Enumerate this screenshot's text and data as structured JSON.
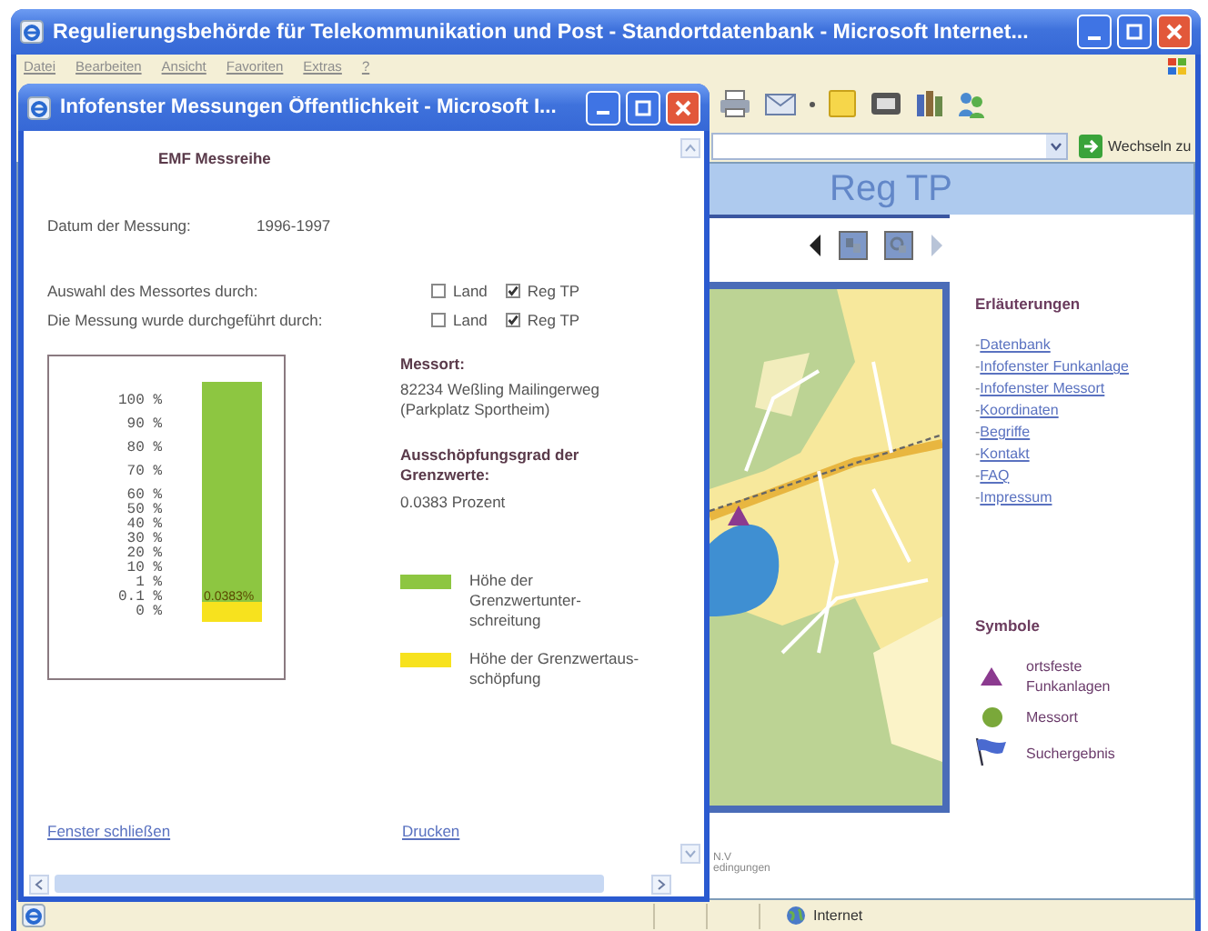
{
  "main_window": {
    "title": "Regulierungsbehörde für Telekommunikation und Post - Standortdatenbank - Microsoft Internet...",
    "menu": [
      "Datei",
      "Bearbeiten",
      "Ansicht",
      "Favoriten",
      "Extras",
      "?"
    ],
    "address_bar": {
      "go_button": "Wechseln zu"
    },
    "header": {
      "title": "Reg TP"
    },
    "map_nav": [
      {
        "kind": "prev",
        "disabled": false
      },
      {
        "kind": "zoom-in",
        "disabled": false
      },
      {
        "kind": "zoom-out",
        "disabled": false
      },
      {
        "kind": "next",
        "disabled": true
      }
    ],
    "map": {
      "kind": "picture"
    },
    "sidebar": {
      "heading": "Erläuterungen",
      "links": [
        {
          "marker": "-",
          "label": "Datenbank"
        },
        {
          "marker": "-",
          "label": "Infofenster Funkanlage"
        },
        {
          "marker": "-",
          "label": "Infofenster Messort"
        },
        {
          "marker": "-",
          "label": "Koordinaten"
        },
        {
          "marker": "-",
          "label": "Begriffe"
        },
        {
          "marker": "-",
          "label": "Kontakt"
        },
        {
          "marker": "-",
          "label": "FAQ"
        },
        {
          "marker": "-",
          "label": "Impressum"
        }
      ],
      "symbols_heading": "Symbole",
      "symbols": [
        {
          "kind": "triangle",
          "label": "ortsfeste Funkanlagen",
          "color": "#8b3a8f"
        },
        {
          "kind": "dot",
          "label": "Messort",
          "color": "#7aa83a"
        },
        {
          "kind": "flag",
          "label": "Suchergebnis",
          "color": "#4a6ad0"
        }
      ]
    },
    "footer": [
      "N.V",
      "edingungen"
    ],
    "status_bar": {
      "zone": "Internet"
    }
  },
  "popup": {
    "title": "Infofenster Messungen Öffentlichkeit - Microsoft I...",
    "heading": "EMF Messreihe",
    "date": {
      "label": "Datum der Messung:",
      "value": "1996-1997"
    },
    "options": [
      {
        "label": "Auswahl des Messortes durch:",
        "choices": [
          {
            "label": "Land",
            "checked": false
          },
          {
            "label": "Reg TP",
            "checked": true
          }
        ]
      },
      {
        "label": "Die Messung wurde durchgeführt durch:",
        "choices": [
          {
            "label": "Land",
            "checked": false
          },
          {
            "label": "Reg TP",
            "checked": true
          }
        ]
      }
    ],
    "gauge": {
      "scale": [
        "100 %",
        "90 %",
        "80 %",
        "70 %",
        "60 %",
        "50 %",
        "40 %",
        "30 %",
        "20 %",
        "10 %",
        "1 %",
        "0.1 %",
        "0 %"
      ],
      "value_label": "0.0383%",
      "segments": [
        {
          "label": "Höhe der Grenzwertunter- schreitung",
          "color": "#8dc641"
        },
        {
          "label": "Höhe der Grenzwertaus- schöpfung",
          "color": "#f7e21e"
        }
      ]
    },
    "location": {
      "label": "Messort:",
      "value": "82234 Weßling Mailingerweg (Parkplatz Sportheim)"
    },
    "utilization": {
      "label": "Ausschöpfungsgrad der Grenzwerte:",
      "value": "0.0383 Prozent"
    },
    "links": [
      "Fenster schließen",
      "Drucken"
    ]
  }
}
